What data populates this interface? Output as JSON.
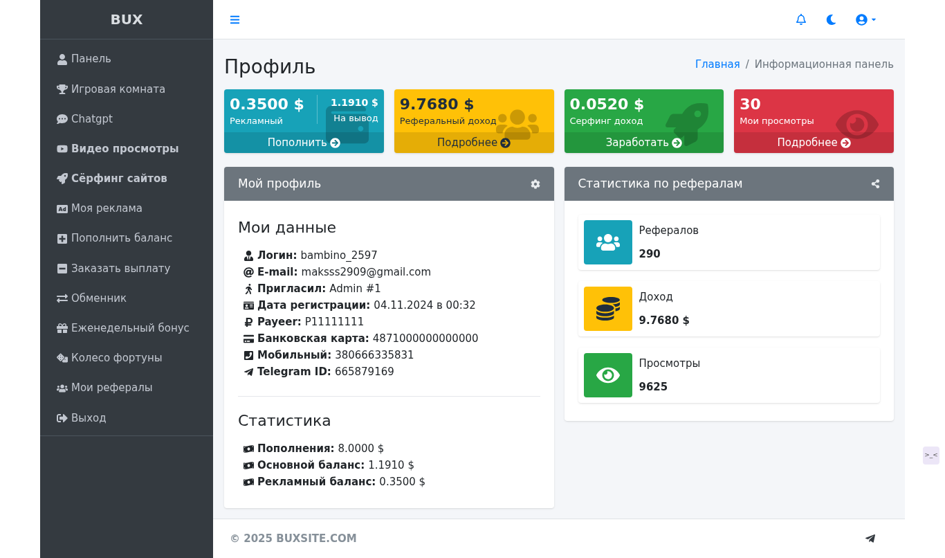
{
  "sidebar": {
    "brand": "BUX",
    "items": [
      {
        "label": "Панель",
        "emphasized": false
      },
      {
        "label": "Игровая комната",
        "emphasized": false
      },
      {
        "label": "Chatgpt",
        "emphasized": false
      },
      {
        "label": "Видео просмотры",
        "emphasized": true
      },
      {
        "label": "Сёрфинг сайтов",
        "emphasized": true
      },
      {
        "label": "Моя реклама",
        "emphasized": false
      },
      {
        "label": "Пополнить баланс",
        "emphasized": false
      },
      {
        "label": "Заказать выплату",
        "emphasized": false
      },
      {
        "label": "Обменник",
        "emphasized": false
      },
      {
        "label": "Еженедельный бонус",
        "emphasized": false
      },
      {
        "label": "Колесо фортуны",
        "emphasized": false
      },
      {
        "label": "Мои рефералы",
        "emphasized": false
      },
      {
        "label": "Выход",
        "emphasized": false
      }
    ]
  },
  "page": {
    "title": "Профиль",
    "breadcrumb_separator": "/",
    "breadcrumb": [
      {
        "label": "Главная",
        "link": true
      },
      {
        "label": "Информационная панель",
        "link": false
      }
    ]
  },
  "small_boxes": [
    {
      "kind": "split",
      "color": "#17a2b8",
      "value": "0.3500 $",
      "label": "Рекламный",
      "value_2": "1.1910 $",
      "label_2": "На вывод",
      "link": "Пополнить"
    },
    {
      "kind": "single",
      "color": "#ffc107",
      "value": "9.7680 $",
      "label": "Реферальный доход",
      "link": "Подробнее"
    },
    {
      "kind": "single",
      "color": "#28a745",
      "value": "0.0520 $",
      "label": "Серфинг доход",
      "link": "Заработать"
    },
    {
      "kind": "single",
      "color": "#dc3545",
      "value": "30",
      "label": "Мои просмотры",
      "link": "Подробнее"
    }
  ],
  "profile_card": {
    "title": "Мой профиль",
    "section_1": "Мои данные",
    "fields": [
      {
        "label": "Логин:",
        "value": "bambino_2597"
      },
      {
        "label": "E-mail:",
        "value": "maksss2909@gmail.com"
      },
      {
        "label": "Пригласил:",
        "value": "Admin #1"
      },
      {
        "label": "Дата регистрации:",
        "value": "04.11.2024 в 00:32"
      },
      {
        "label": "Payeer:",
        "value": "P11111111"
      },
      {
        "label": "Банковская карта:",
        "value": "4871000000000000"
      },
      {
        "label": "Мобильный:",
        "value": "380666335831"
      },
      {
        "label": "Telegram ID:",
        "value": "665879169"
      }
    ],
    "section_2": "Статистика",
    "stats": [
      {
        "label": "Пополнения:",
        "value": "8.0000 $"
      },
      {
        "label": "Основной баланс:",
        "value": "1.1910 $"
      },
      {
        "label": "Рекламный баланс:",
        "value": "0.3500 $"
      }
    ]
  },
  "referral_card": {
    "title": "Статистика по рефералам",
    "items": [
      {
        "color": "#17a2b8",
        "label": "Рефералов",
        "value": "290"
      },
      {
        "color": "#ffc107",
        "label": "Доход",
        "value": "9.7680 $"
      },
      {
        "color": "#28a745",
        "label": "Просмотры",
        "value": "9625"
      }
    ]
  },
  "footer": {
    "copyright": "© 2025 BUXSITE.COM"
  },
  "widget": {
    "label": ">_<"
  }
}
